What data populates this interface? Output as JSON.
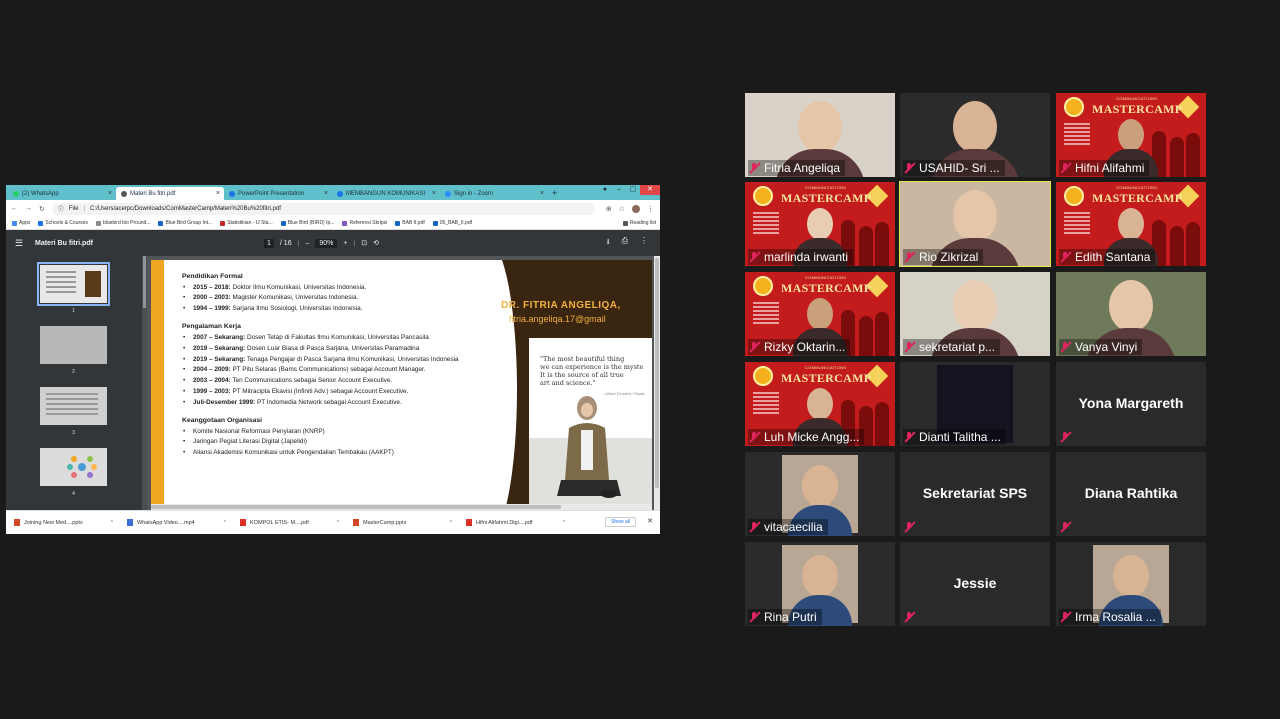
{
  "browser": {
    "tabs": [
      {
        "label": "(2) WhatsApp",
        "color": "#25d366"
      },
      {
        "label": "Materi Bu fitri.pdf",
        "color": "#555555"
      },
      {
        "label": "PowerPoint Presentation",
        "color": "#1a73e8"
      },
      {
        "label": "MEMBANGUN KOMUNIKASI",
        "color": "#1a73e8"
      },
      {
        "label": "Sign in - Zoom",
        "color": "#2d8cff"
      }
    ],
    "url": "C:/Users/acerpc/Downloads/ComMasterCamp/Materi%20Bu%20fitri.pdf",
    "file_label": "File",
    "bookmarks": [
      "Apps",
      "Schools & Courses",
      "bluebird bio Pround...",
      "Blue Bird Group Int...",
      "Statistikian - IJ Sta...",
      "Blue Bird (BIRD) Ip...",
      "Referensi Skripsi",
      "BAB II.pdf",
      "05_BAB_II.pdf"
    ],
    "reading_list": "Reading list"
  },
  "pdf": {
    "title": "Materi Bu fitri.pdf",
    "page_current": "1",
    "page_total": "/ 16",
    "zoom": "90%",
    "thumb_numbers": [
      "1",
      "2",
      "3",
      "4"
    ],
    "sections": [
      {
        "heading": "Pendidikan Formal",
        "items": [
          {
            "year": "2015 – 2018:",
            "text": " Doktor Ilmu Komunikasi, Universitas Indonesia."
          },
          {
            "year": "2000 – 2003:",
            "text": " Magister Komunikasi, Universitas Indonesia."
          },
          {
            "year": "1994 – 1999:",
            "text": " Sarjana Ilmu Sosiologi, Universitas Indonesia."
          }
        ]
      },
      {
        "heading": "Pengalaman Kerja",
        "items": [
          {
            "year": "2007 – Sekarang:",
            "text": " Dosen Tetap di Fakultas Ilmu Komunikasi, Universitas Pancasila"
          },
          {
            "year": "2019 – Sekarang:",
            "text": " Dosen Luar Biasa di Pasca Sarjana, Universitas Paramadina"
          },
          {
            "year": "2019 – Sekarang:",
            "text": " Tenaga Pengajar di Pasca Sarjana Ilmu Komunikasi, Universitas Indonesia"
          },
          {
            "year": "2004 – 2009:",
            "text": " PT Pitu Selaras (Bams Communications) sebagai Account Manager."
          },
          {
            "year": "2003 – 2004:",
            "text": " Ten Communications sebagai Senior Account Executive."
          },
          {
            "year": "1999 – 2003:",
            "text": " PT Mitracipta Ekavisi (Infiniti Adv.) sebagai Account Executive."
          },
          {
            "year": "Juli-Desember 1999:",
            "text": " PT Indomedia Network sebagai Account Executive."
          }
        ]
      },
      {
        "heading": "Keanggotaan Organisasi",
        "items": [
          {
            "year": "",
            "text": "Komite Nasional Reformasi Penyiaran (KNRP)"
          },
          {
            "year": "",
            "text": "Jaringan Pegiat Literasi Digital (Japelidi)"
          },
          {
            "year": "",
            "text": "Aliansi Akademisi Komunikasi untuk Pengendalian Tembakau (AAKPT)"
          }
        ]
      }
    ],
    "name": "DR. FITRIA ANGELIQA,",
    "email": "fitria.angeliqa.17@gmail",
    "quote_lines": [
      "\"The most beautiful thing",
      "we can experience is the myste",
      "It is the source of all true",
      "art and science.\""
    ],
    "quote_author": "- Albert Einstein, Physic"
  },
  "downloads": {
    "items": [
      {
        "label": "Joining New Med....pptx",
        "color": "#d24726"
      },
      {
        "label": "WhatsApp Video....mp4",
        "color": "#3b6ad9"
      },
      {
        "label": "KOMPOL ETIS- M....pdf",
        "color": "#d93025"
      },
      {
        "label": "MasterCamp.pptx",
        "color": "#d24726"
      },
      {
        "label": "Hifni Alifahmi Digi....pdf",
        "color": "#d93025"
      }
    ],
    "show_all": "Show all"
  },
  "participants": [
    {
      "name": "Fitria Angeliqa",
      "type": "video",
      "bg": "#d9d2c8"
    },
    {
      "name": "USAHID- Sri ...",
      "type": "video",
      "bg": "#2b2b2b"
    },
    {
      "name": "Hifni Alifahmi",
      "type": "mastercamp"
    },
    {
      "name": "marlinda irwanti",
      "type": "mastercamp"
    },
    {
      "name": "Rio Zikrizal",
      "type": "video",
      "bg": "#c9b7a2"
    },
    {
      "name": "Edith Santana",
      "type": "mastercamp"
    },
    {
      "name": "Rizky Oktarin...",
      "type": "mastercamp"
    },
    {
      "name": "sekretariat p...",
      "type": "video",
      "bg": "#d6d2c6"
    },
    {
      "name": "Vanya Vinyi",
      "type": "video",
      "bg": "#6f7a5a"
    },
    {
      "name": "Luh Micke Angg...",
      "type": "mastercamp"
    },
    {
      "name": "Dianti Talitha ...",
      "type": "dark"
    },
    {
      "name": "Yona Margareth",
      "type": "nameonly"
    },
    {
      "name": "vitacaecilia",
      "type": "photo"
    },
    {
      "name": "Sekretariat SPS",
      "type": "nameonly"
    },
    {
      "name": "Diana Rahtika",
      "type": "nameonly"
    },
    {
      "name": "Rina Putri",
      "type": "photo"
    },
    {
      "name": "Jessie",
      "type": "nameonly"
    },
    {
      "name": "Irma Rosalia ...",
      "type": "photo"
    }
  ],
  "mastercamp": {
    "title": "MASTERCAMP",
    "sub": "COMMUNICATIONS"
  }
}
